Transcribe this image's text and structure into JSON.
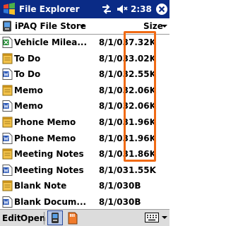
{
  "titlebar": {
    "app_title": "File Explorer",
    "time": "2:38",
    "start_icon": "windows-flag-icon",
    "connection_icon": "connectivity-icon",
    "volume_icon": "speaker-icon",
    "ok_icon": "close-icon",
    "bg_color": "#0a2b86"
  },
  "location": {
    "folder_label": "iPAQ File Store",
    "sort_label": "Size"
  },
  "files": [
    {
      "name": "Vehicle Milea...",
      "date": "8/1/03",
      "size": "7.32K",
      "icon": "excel-doc-icon"
    },
    {
      "name": "To Do",
      "date": "8/1/03",
      "size": "3.02K",
      "icon": "note-icon"
    },
    {
      "name": "To Do",
      "date": "8/1/03",
      "size": "2.55K",
      "icon": "word-doc-icon"
    },
    {
      "name": "Memo",
      "date": "8/1/03",
      "size": "2.06K",
      "icon": "note-icon"
    },
    {
      "name": "Memo",
      "date": "8/1/03",
      "size": "2.06K",
      "icon": "word-doc-icon"
    },
    {
      "name": "Phone Memo",
      "date": "8/1/03",
      "size": "1.96K",
      "icon": "note-icon"
    },
    {
      "name": "Phone Memo",
      "date": "8/1/03",
      "size": "1.96K",
      "icon": "word-doc-icon"
    },
    {
      "name": "Meeting Notes",
      "date": "8/1/03",
      "size": "1.86K",
      "icon": "note-icon"
    },
    {
      "name": "Meeting Notes",
      "date": "8/1/03",
      "size": "1.55K",
      "icon": "word-doc-icon"
    },
    {
      "name": "Blank Note",
      "date": "8/1/03",
      "size": "0B",
      "icon": "note-icon"
    },
    {
      "name": "Blank Docum...",
      "date": "8/1/03",
      "size": "0B",
      "icon": "word-doc-icon"
    }
  ],
  "highlight_color": "#f06a14",
  "menubar": {
    "edit_label": "Edit",
    "open_label": "Open",
    "store_button_icon": "file-store-icon",
    "storage_button_icon": "storage-card-icon",
    "keyboard_icon": "keyboard-icon"
  }
}
